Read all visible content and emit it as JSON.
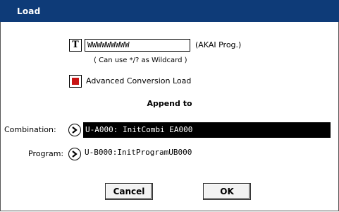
{
  "title": "Load",
  "filename": {
    "t_label": "T",
    "value": "WWWWWWWWW",
    "suffix": "(AKAI Prog.)",
    "hint": "( Can use */? as Wildcard )"
  },
  "advanced": {
    "label": "Advanced Conversion Load",
    "checked": true
  },
  "append_to": {
    "header": "Append to",
    "combination": {
      "label": "Combination:",
      "value": "U-A000: InitCombi EA000"
    },
    "program": {
      "label": "Program:",
      "value": "U-B000:InitProgramUB000"
    }
  },
  "buttons": {
    "cancel": "Cancel",
    "ok": "OK"
  },
  "colors": {
    "titlebar": "#0e3b78",
    "checkbox_fill": "#c81414",
    "selected_bg": "#000000"
  }
}
